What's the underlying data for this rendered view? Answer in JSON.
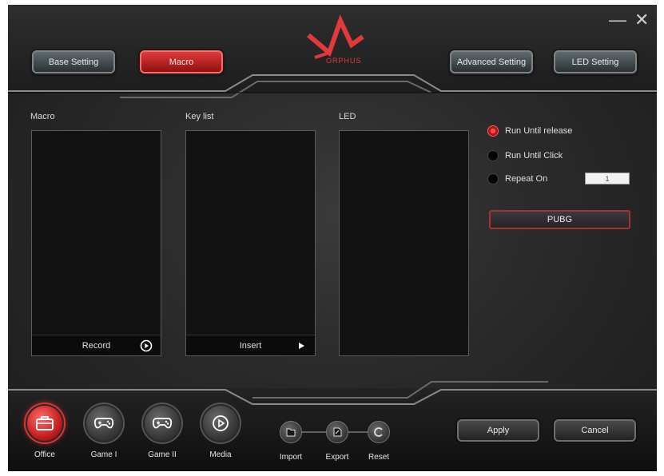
{
  "window": {
    "minimize_glyph": "—",
    "close_glyph": "✕"
  },
  "brand": {
    "logo_text": "ORPHUS",
    "accent_color": "#e23a3a"
  },
  "tabs": [
    {
      "label": "Base Setting",
      "active": false
    },
    {
      "label": "Macro",
      "active": true
    },
    {
      "label": "Advanced Setting",
      "active": false
    },
    {
      "label": "LED Setting",
      "active": false
    }
  ],
  "panels": {
    "macro": {
      "title": "Macro",
      "footer": "Record",
      "footer_icon": "play-circle-icon"
    },
    "keylist": {
      "title": "Key list",
      "footer": "Insert",
      "footer_icon": "play-triangle-icon"
    },
    "led": {
      "title": "LED"
    }
  },
  "options": {
    "run_until_release": {
      "label": "Run Until release",
      "selected": true
    },
    "run_until_click": {
      "label": "Run Until Click",
      "selected": false
    },
    "repeat_on": {
      "label": "Repeat On",
      "selected": false,
      "value": "1"
    }
  },
  "profile_button": {
    "label": "PUBG"
  },
  "profiles": [
    {
      "label": "Office",
      "icon": "briefcase-icon",
      "active": true
    },
    {
      "label": "Game I",
      "icon": "gamepad-icon",
      "active": false
    },
    {
      "label": "Game II",
      "icon": "gamepad-icon",
      "active": false
    },
    {
      "label": "Media",
      "icon": "play-icon",
      "active": false
    }
  ],
  "file_actions": [
    {
      "label": "Import",
      "icon": "import-icon"
    },
    {
      "label": "Export",
      "icon": "export-icon"
    },
    {
      "label": "Reset",
      "icon": "reset-icon"
    }
  ],
  "footer_actions": {
    "apply": "Apply",
    "cancel": "Cancel"
  }
}
